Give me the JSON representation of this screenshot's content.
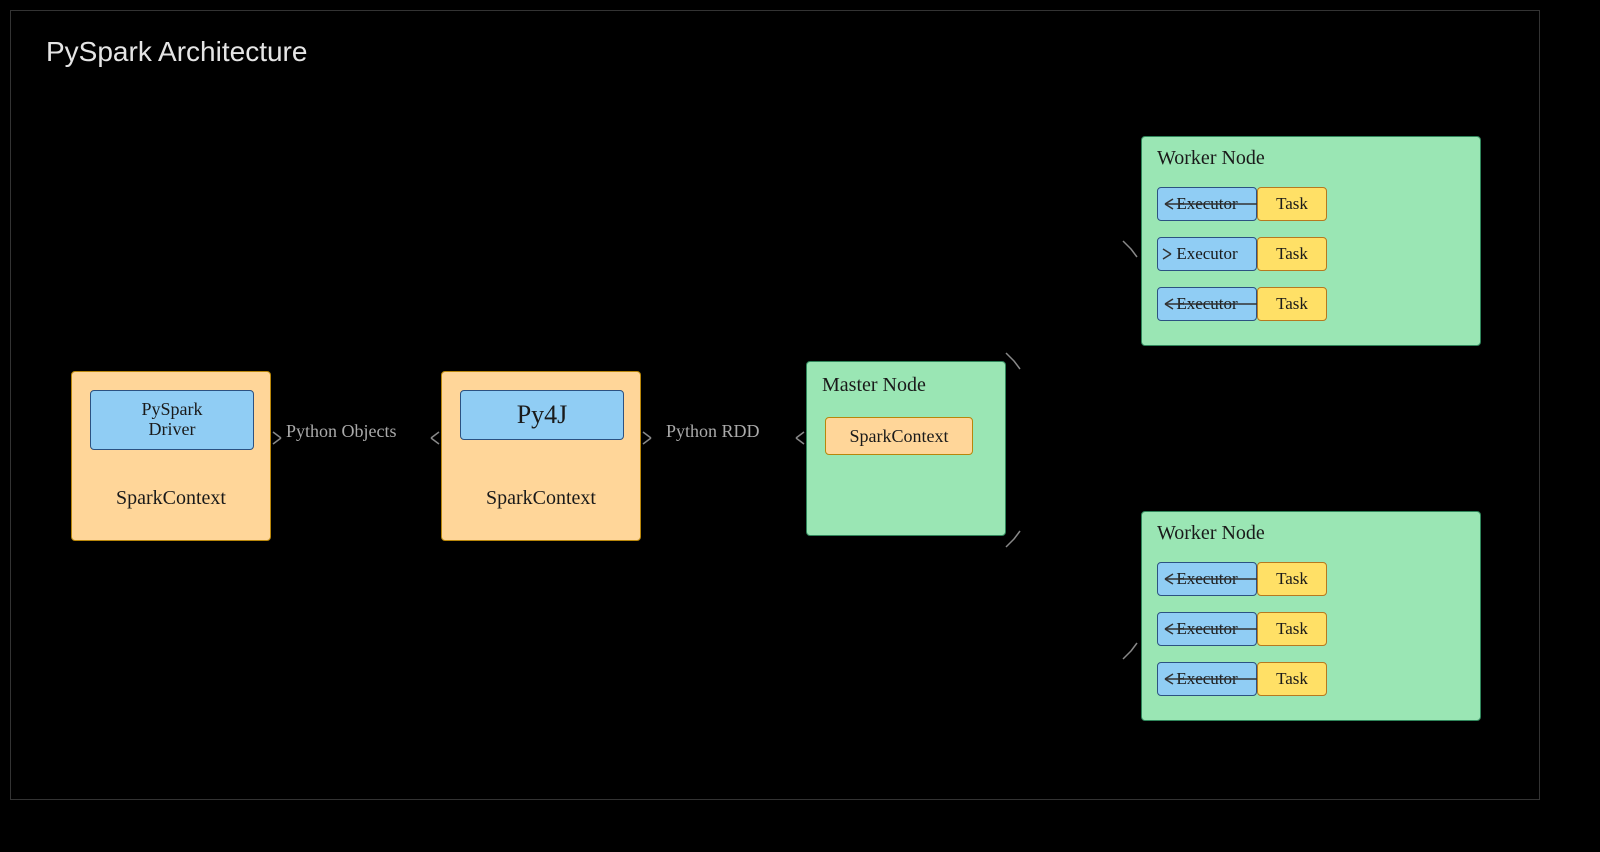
{
  "title": "PySpark Architecture",
  "driver_box": {
    "inner_label": "PySpark\nDriver",
    "footer_label": "SparkContext"
  },
  "py4j_box": {
    "inner_label": "Py4J",
    "footer_label": "SparkContext"
  },
  "master_box": {
    "title": "Master Node",
    "inner_label": "SparkContext"
  },
  "worker_label": "Worker Node",
  "executor_label": "Executor",
  "task_label": "Task",
  "edge_labels": {
    "python_objects": "Python Objects",
    "python_rdd": "Python RDD"
  }
}
